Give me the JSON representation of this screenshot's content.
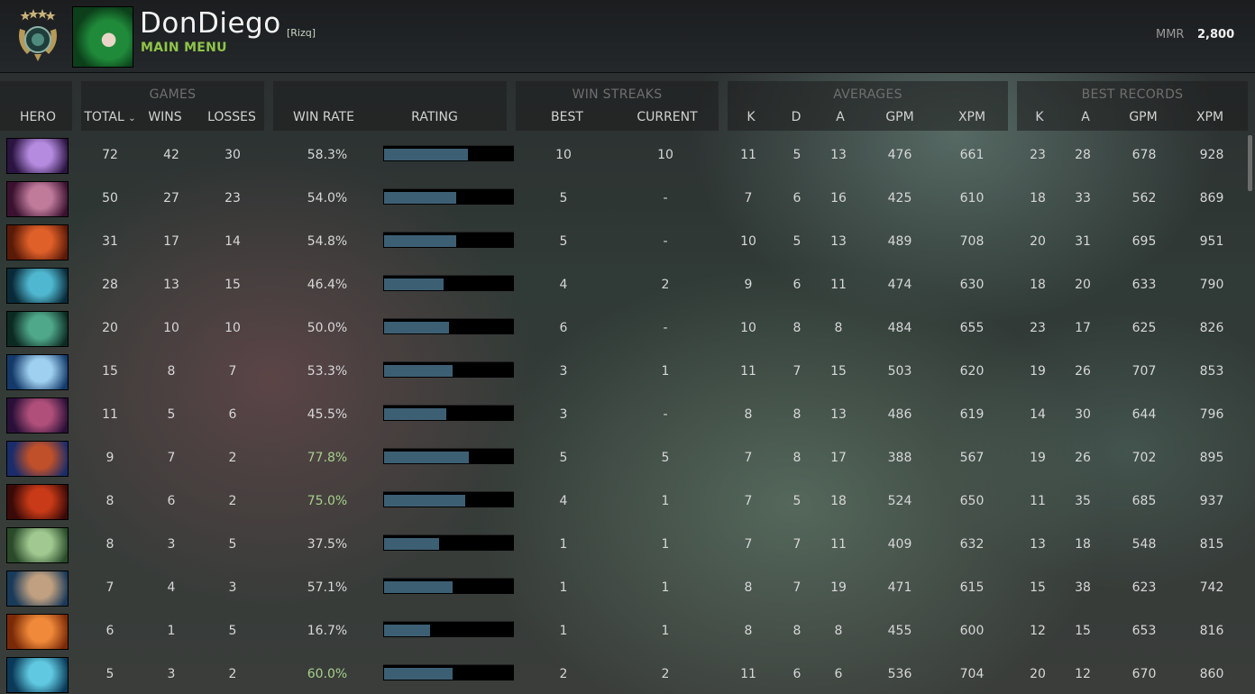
{
  "header": {
    "player_name": "DonDiego",
    "clan_tag": "[Rizq]",
    "main_menu": "MAIN MENU",
    "mmr_label": "MMR",
    "mmr_value": "2,800"
  },
  "columns": {
    "hero": "HERO",
    "games_group": "GAMES",
    "total": "TOTAL",
    "wins": "WINS",
    "losses": "LOSSES",
    "win_rate": "WIN RATE",
    "rating": "RATING",
    "win_streaks_group": "WIN STREAKS",
    "best": "BEST",
    "current": "CURRENT",
    "averages_group": "AVERAGES",
    "avg_k": "K",
    "avg_d": "D",
    "avg_a": "A",
    "avg_gpm": "GPM",
    "avg_xpm": "XPM",
    "best_records_group": "BEST RECORDS",
    "rec_k": "K",
    "rec_a": "A",
    "rec_gpm": "GPM",
    "rec_xpm": "XPM"
  },
  "rows": [
    {
      "hero_colors": [
        "#2a1440",
        "#b58be0"
      ],
      "total": "72",
      "wins": "42",
      "losses": "30",
      "win_rate": "58.3%",
      "rating": 0.65,
      "best": "10",
      "current": "10",
      "k": "11",
      "d": "5",
      "a": "13",
      "gpm": "476",
      "xpm": "661",
      "rk": "23",
      "ra": "28",
      "rgpm": "678",
      "rxpm": "928"
    },
    {
      "hero_colors": [
        "#3a1230",
        "#c07a9a"
      ],
      "total": "50",
      "wins": "27",
      "losses": "23",
      "win_rate": "54.0%",
      "rating": 0.56,
      "best": "5",
      "current": "-",
      "k": "7",
      "d": "6",
      "a": "16",
      "gpm": "425",
      "xpm": "610",
      "rk": "18",
      "ra": "33",
      "rgpm": "562",
      "rxpm": "869"
    },
    {
      "hero_colors": [
        "#5a1a08",
        "#e0602a"
      ],
      "total": "31",
      "wins": "17",
      "losses": "14",
      "win_rate": "54.8%",
      "rating": 0.56,
      "best": "5",
      "current": "-",
      "k": "10",
      "d": "5",
      "a": "13",
      "gpm": "489",
      "xpm": "708",
      "rk": "20",
      "ra": "31",
      "rgpm": "695",
      "rxpm": "951"
    },
    {
      "hero_colors": [
        "#0a2a38",
        "#4fb8d0"
      ],
      "total": "28",
      "wins": "13",
      "losses": "15",
      "win_rate": "46.4%",
      "rating": 0.46,
      "best": "4",
      "current": "2",
      "k": "9",
      "d": "6",
      "a": "11",
      "gpm": "474",
      "xpm": "630",
      "rk": "18",
      "ra": "20",
      "rgpm": "633",
      "rxpm": "790"
    },
    {
      "hero_colors": [
        "#0c2a22",
        "#4fa88a"
      ],
      "total": "20",
      "wins": "10",
      "losses": "10",
      "win_rate": "50.0%",
      "rating": 0.5,
      "best": "6",
      "current": "-",
      "k": "10",
      "d": "8",
      "a": "8",
      "gpm": "484",
      "xpm": "655",
      "rk": "23",
      "ra": "17",
      "rgpm": "625",
      "rxpm": "826"
    },
    {
      "hero_colors": [
        "#143a6a",
        "#9fd0f0"
      ],
      "total": "15",
      "wins": "8",
      "losses": "7",
      "win_rate": "53.3%",
      "rating": 0.53,
      "best": "3",
      "current": "1",
      "k": "11",
      "d": "7",
      "a": "15",
      "gpm": "503",
      "xpm": "620",
      "rk": "19",
      "ra": "26",
      "rgpm": "707",
      "rxpm": "853"
    },
    {
      "hero_colors": [
        "#2a1038",
        "#b0507a"
      ],
      "total": "11",
      "wins": "5",
      "losses": "6",
      "win_rate": "45.5%",
      "rating": 0.48,
      "best": "3",
      "current": "-",
      "k": "8",
      "d": "8",
      "a": "13",
      "gpm": "486",
      "xpm": "619",
      "rk": "14",
      "ra": "30",
      "rgpm": "644",
      "rxpm": "796"
    },
    {
      "hero_colors": [
        "#1a2c6a",
        "#c0502a"
      ],
      "total": "9",
      "wins": "7",
      "losses": "2",
      "win_rate": "77.8%",
      "rating": 0.66,
      "best": "5",
      "current": "5",
      "k": "7",
      "d": "8",
      "a": "17",
      "gpm": "388",
      "xpm": "567",
      "rk": "19",
      "ra": "26",
      "rgpm": "702",
      "rxpm": "895"
    },
    {
      "hero_colors": [
        "#3a0a08",
        "#c83a18"
      ],
      "total": "8",
      "wins": "6",
      "losses": "2",
      "win_rate": "75.0%",
      "rating": 0.63,
      "best": "4",
      "current": "1",
      "k": "7",
      "d": "5",
      "a": "18",
      "gpm": "524",
      "xpm": "650",
      "rk": "11",
      "ra": "35",
      "rgpm": "685",
      "rxpm": "937"
    },
    {
      "hero_colors": [
        "#2a4a2a",
        "#a0c890"
      ],
      "total": "8",
      "wins": "3",
      "losses": "5",
      "win_rate": "37.5%",
      "rating": 0.43,
      "best": "1",
      "current": "1",
      "k": "7",
      "d": "7",
      "a": "11",
      "gpm": "409",
      "xpm": "632",
      "rk": "13",
      "ra": "18",
      "rgpm": "548",
      "rxpm": "815"
    },
    {
      "hero_colors": [
        "#1a3a5a",
        "#c0a080"
      ],
      "total": "7",
      "wins": "4",
      "losses": "3",
      "win_rate": "57.1%",
      "rating": 0.53,
      "best": "1",
      "current": "1",
      "k": "8",
      "d": "7",
      "a": "19",
      "gpm": "471",
      "xpm": "615",
      "rk": "15",
      "ra": "38",
      "rgpm": "623",
      "rxpm": "742"
    },
    {
      "hero_colors": [
        "#7a2a08",
        "#f08a3a"
      ],
      "total": "6",
      "wins": "1",
      "losses": "5",
      "win_rate": "16.7%",
      "rating": 0.36,
      "best": "1",
      "current": "1",
      "k": "8",
      "d": "8",
      "a": "8",
      "gpm": "455",
      "xpm": "600",
      "rk": "12",
      "ra": "15",
      "rgpm": "653",
      "rxpm": "816"
    },
    {
      "hero_colors": [
        "#0a3a58",
        "#60c8e0"
      ],
      "total": "5",
      "wins": "3",
      "losses": "2",
      "win_rate": "60.0%",
      "rating": 0.53,
      "best": "2",
      "current": "2",
      "k": "11",
      "d": "6",
      "a": "6",
      "gpm": "536",
      "xpm": "704",
      "rk": "20",
      "ra": "12",
      "rgpm": "670",
      "rxpm": "860"
    }
  ],
  "colors": {
    "rating_fill": "#3d5f74",
    "good_winrate": "#a6d08a",
    "menu_green": "#8fc44a"
  }
}
